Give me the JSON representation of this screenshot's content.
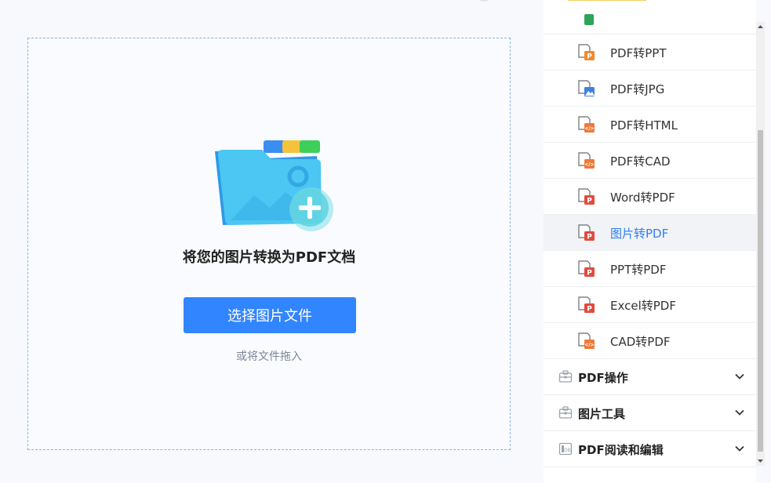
{
  "upload": {
    "title": "将您的图片转换为PDF文档",
    "button_label": "选择图片文件",
    "drag_hint": "或将文件拖入"
  },
  "menu": {
    "items": [
      {
        "label": "PDF转PPT",
        "icon": "pdf-to-ppt-file-icon",
        "badge": "P",
        "badge_color": "#f08b2b"
      },
      {
        "label": "PDF转JPG",
        "icon": "pdf-to-jpg-file-icon",
        "badge": "img",
        "badge_color": "#3d82e0"
      },
      {
        "label": "PDF转HTML",
        "icon": "pdf-to-html-file-icon",
        "badge": "</>",
        "badge_color": "#ef7a3a"
      },
      {
        "label": "PDF转CAD",
        "icon": "pdf-to-cad-file-icon",
        "badge": "</>",
        "badge_color": "#ef7a3a"
      },
      {
        "label": "Word转PDF",
        "icon": "word-to-pdf-file-icon",
        "badge": "P",
        "badge_color": "#e04b3e"
      },
      {
        "label": "图片转PDF",
        "icon": "image-to-pdf-file-icon",
        "badge": "P",
        "badge_color": "#e04b3e",
        "active": true
      },
      {
        "label": "PPT转PDF",
        "icon": "ppt-to-pdf-file-icon",
        "badge": "P",
        "badge_color": "#e04b3e"
      },
      {
        "label": "Excel转PDF",
        "icon": "excel-to-pdf-file-icon",
        "badge": "P",
        "badge_color": "#e04b3e"
      },
      {
        "label": "CAD转PDF",
        "icon": "cad-to-pdf-file-icon",
        "badge": "</>",
        "badge_color": "#ef7a3a"
      }
    ],
    "sections": [
      {
        "label": "PDF操作",
        "icon": "toolbox-icon"
      },
      {
        "label": "图片工具",
        "icon": "toolbox-icon"
      },
      {
        "label": "PDF阅读和编辑",
        "icon": "reader-icon"
      }
    ]
  },
  "colors": {
    "accent": "#3185ff",
    "active_text": "#2f7cf6",
    "dashed_border": "#8fb3d9"
  }
}
